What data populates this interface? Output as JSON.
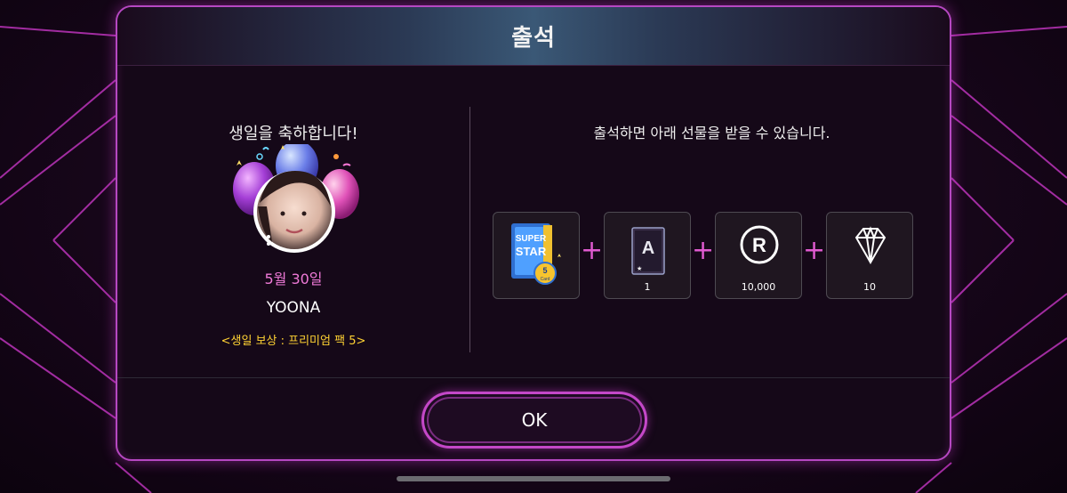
{
  "dialog": {
    "title": "출석",
    "left": {
      "message": "생일을 축하합니다!",
      "date": "5월 30일",
      "name": "YOONA",
      "reward": "<생일 보상 : 프리미엄 팩 5>"
    },
    "right": {
      "message": "출석하면 아래 선물을 받을 수 있습니다.",
      "items": [
        {
          "icon": "card-pack-icon",
          "pack_text_1": "SUPER",
          "pack_text_2": "STAR",
          "badge_num": "5",
          "badge_text": "Card",
          "qty": ""
        },
        {
          "icon": "a-grade-card-icon",
          "grade": "A",
          "qty": "1"
        },
        {
          "icon": "r-coin-icon",
          "letter": "R",
          "qty": "10,000"
        },
        {
          "icon": "diamond-icon",
          "qty": "10"
        }
      ],
      "plus": "+"
    },
    "ok_label": "OK"
  },
  "colors": {
    "accent": "#c448c8",
    "date": "#f07ad8",
    "reward": "#ffd233"
  }
}
